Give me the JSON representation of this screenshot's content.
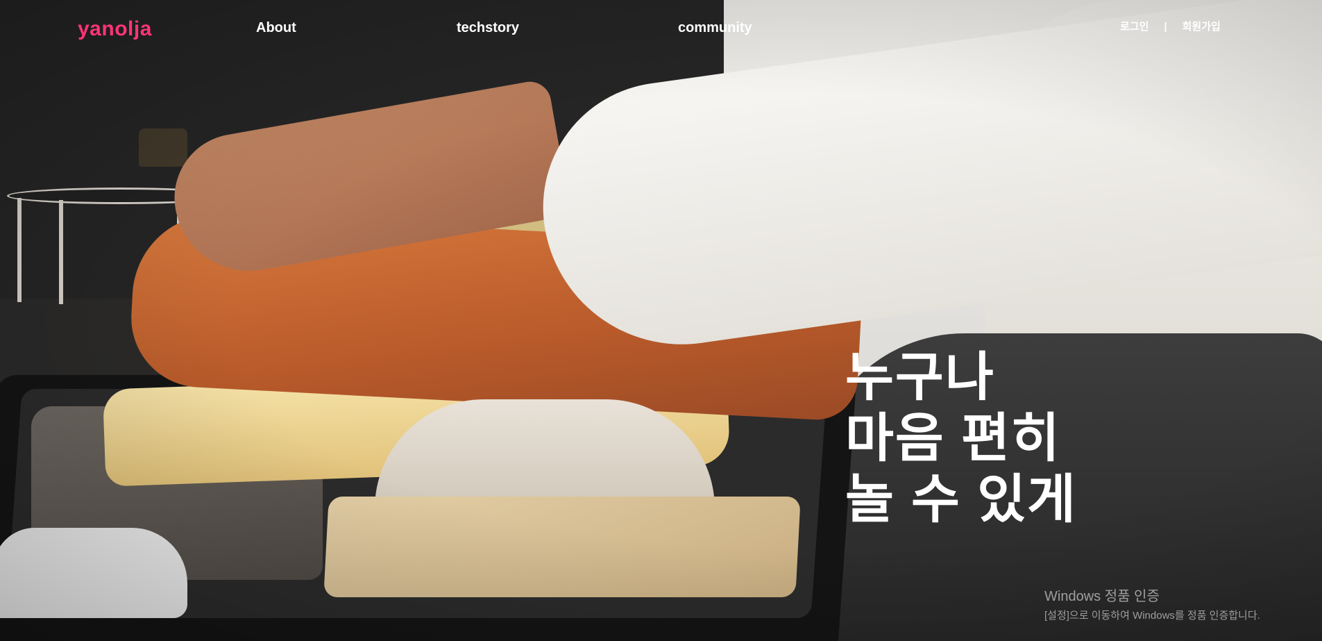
{
  "brand": {
    "logo_text": "yanolja",
    "accent_color": "#ff3478"
  },
  "nav": {
    "items": [
      {
        "label": "About"
      },
      {
        "label": "techstory"
      },
      {
        "label": "community"
      }
    ]
  },
  "auth": {
    "login_label": "로그인",
    "separator": "|",
    "signup_label": "회원가입"
  },
  "hero": {
    "headline_lines": [
      "누구나",
      "마음 편히",
      "놀 수 있게"
    ]
  },
  "windows_activation": {
    "title": "Windows 정품 인증",
    "subtitle": "[설정]으로 이동하여 Windows를 정품 인증합니다."
  }
}
